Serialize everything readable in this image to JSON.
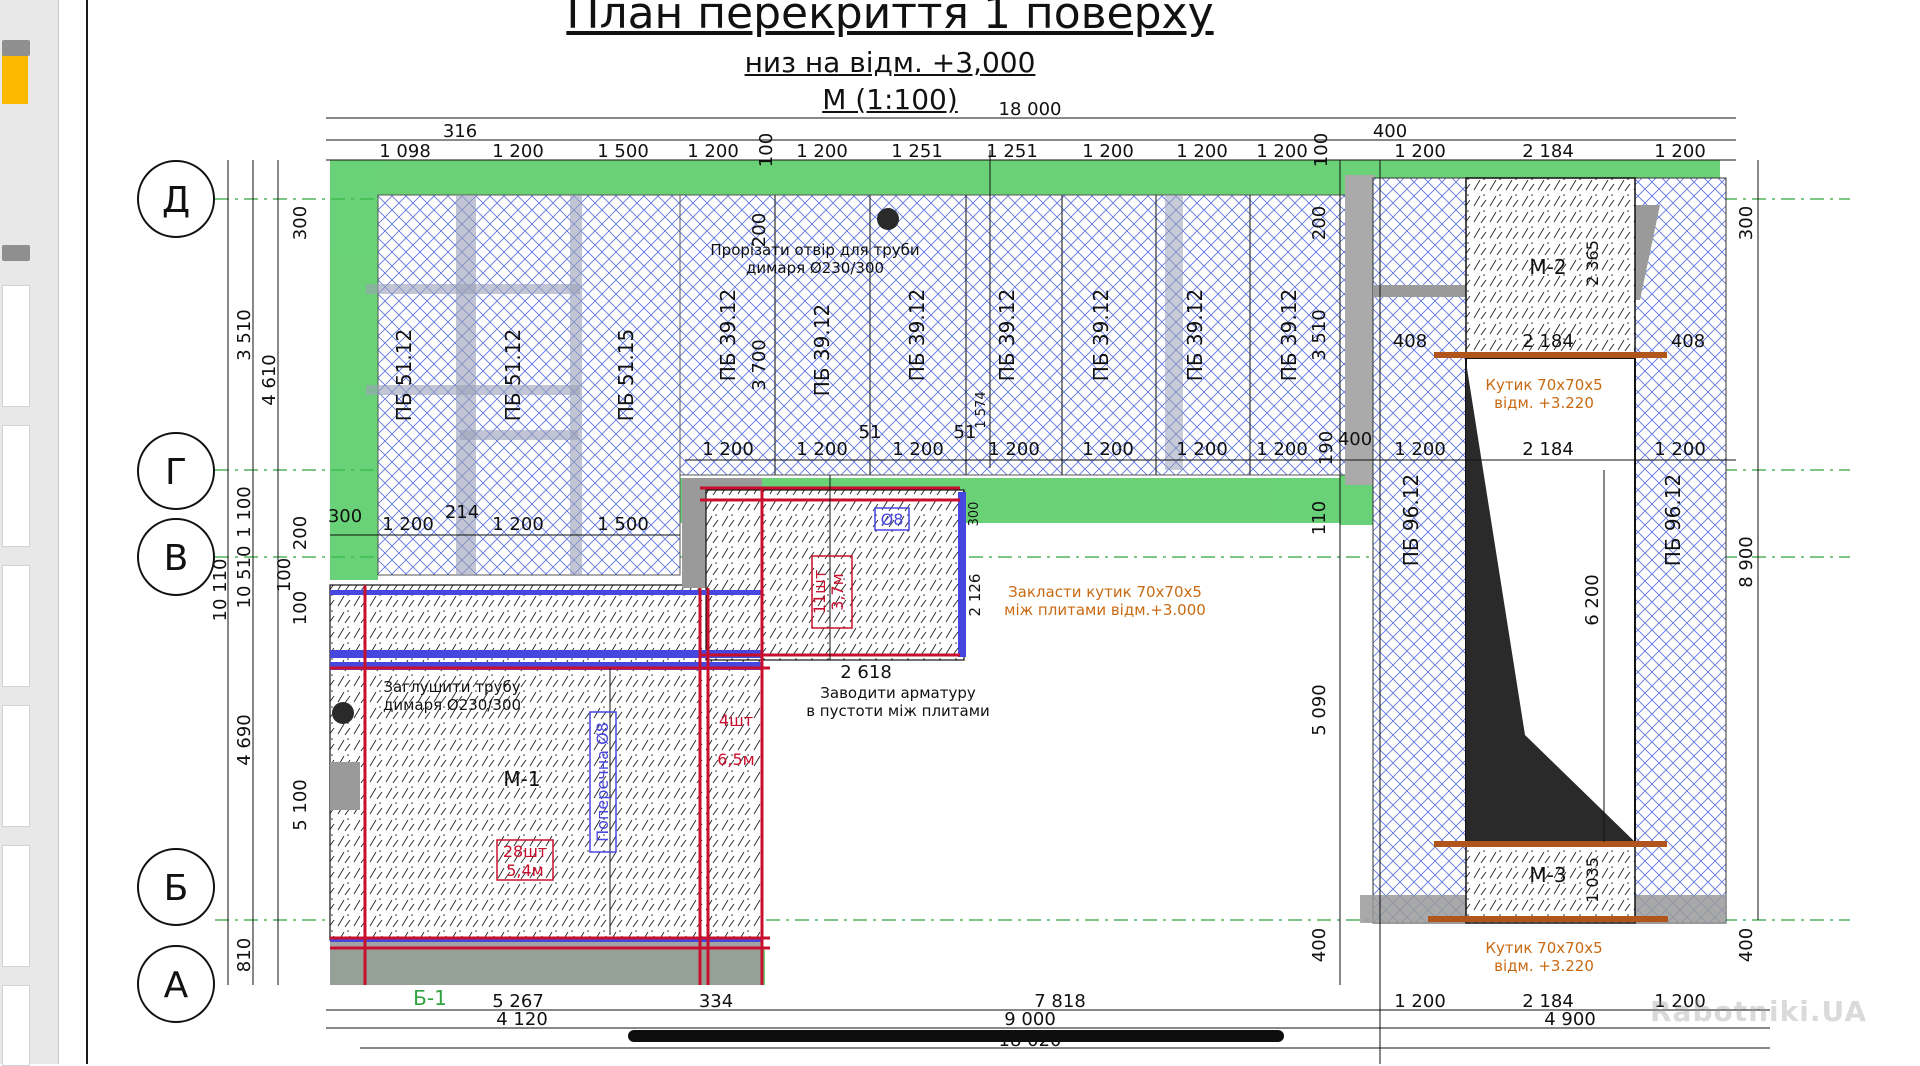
{
  "title": {
    "main": "План перекриття 1 поверху",
    "level": "низ на відм. +3,000",
    "scale": "М (1:100)"
  },
  "axes": {
    "left": [
      "Д",
      "Г",
      "В",
      "Б",
      "А"
    ]
  },
  "dims": {
    "top_total": "18 000",
    "top_316": "316",
    "top_400": "400",
    "top_row": [
      "1 098",
      "1 200",
      "1 500",
      "1 200",
      "100",
      "1 200",
      "1 251",
      "1 251",
      "1 200",
      "1 200",
      "1 200",
      "100",
      "1 200",
      "2 184",
      "1 200"
    ],
    "mid_row": [
      "1 200",
      "1 200",
      "1 200",
      "1 200",
      "1 200",
      "1 200",
      "1 200",
      "190",
      "400",
      "1 200",
      "2 184",
      "1 200"
    ],
    "low_row": [
      "300",
      "1 200",
      "214",
      "1 200",
      "1 500"
    ],
    "right_300": "300",
    "right_8900": "8 900",
    "left_outer": "10 110",
    "left_second": "10 510",
    "left_3510": "3 510",
    "left_4610": "4 610",
    "left_300": "300",
    "left_1100": "1 100",
    "left_200": "200",
    "left_100a": "100",
    "left_100b": "100",
    "left_4690": "4 690",
    "left_5100": "5 100",
    "left_810": "810",
    "bot_5267": "5 267",
    "bot_334": "334",
    "bot_7818": "7 818",
    "bot_4120": "4 120",
    "bot_9000": "9 000",
    "bot_18020": "18 020",
    "bot_1200a": "1 200",
    "bot_2184": "2 184",
    "bot_1200b": "1 200",
    "bot_4900": "4 900",
    "inner_200a": "200",
    "inner_3700": "3 700",
    "inner_200b": "200",
    "inner_3510": "3 510",
    "inner_110": "110",
    "inner_5090": "5 090",
    "inner_400": "400",
    "inner_1574": "1 574",
    "inner_51a": "51",
    "inner_51b": "51",
    "inner_300s": "300",
    "inner_2126": "2 126",
    "inner_2618": "2 618",
    "inner_6200": "6 200",
    "inner_2365": "2 365",
    "inner_1035": "1 035",
    "inner_408a": "408",
    "inner_408b": "408",
    "inner_2184": "2 184",
    "right_400": "400"
  },
  "slabs": {
    "pb5112a": "ПБ 51.12",
    "pb5112b": "ПБ 51.12",
    "pb5115": "ПБ 51.15",
    "pb3912": [
      "ПБ 39.12",
      "ПБ 39.12",
      "ПБ 39.12",
      "ПБ 39.12",
      "ПБ 39.12",
      "ПБ 39.12",
      "ПБ 39.12"
    ],
    "pb9612a": "ПБ 96.12",
    "pb9612b": "ПБ 96.12"
  },
  "monolith": {
    "m1": "М-1",
    "m2": "М-2",
    "m3": "М-3",
    "b1": "Б-1"
  },
  "notes": {
    "hole_1": "Прорізати отвір для труби",
    "hole_2": "димаря Ø230/300",
    "plug_1": "Заглушити трубу",
    "plug_2": "димаря Ø230/300",
    "rebar_1": "Заводити арматуру",
    "rebar_2": "в пустоти між плитами",
    "angle_1": "Закласти кутик 70х70х5",
    "angle_2": "між плитами відм.+3.000",
    "corner_top_1": "Кутик 70х70х5",
    "corner_top_2": "відм. +3.220",
    "corner_bot_1": "Кутик 70х70х5",
    "corner_bot_2": "відм. +3.220"
  },
  "rebar": {
    "r1_count": "28шт",
    "r1_len": "5,4м",
    "r2_count": "4шт",
    "r2_len": "6,5м",
    "r3_count": "11шт",
    "r3_len": "3,7м",
    "cross": "Поперечна Ø8",
    "d8": "Ø8"
  },
  "watermark": "Rabotniki.UA",
  "colors": {
    "green_band": "#38c24a",
    "slab_hatch_blue": "#3a56d6",
    "rebar_red": "#c8102e",
    "beam_blue": "#4747e0",
    "note_orange": "#c96a12",
    "corner_brown": "#b0561d",
    "concrete_grey": "#9a9a9a",
    "axis_green": "#2fa33f"
  }
}
